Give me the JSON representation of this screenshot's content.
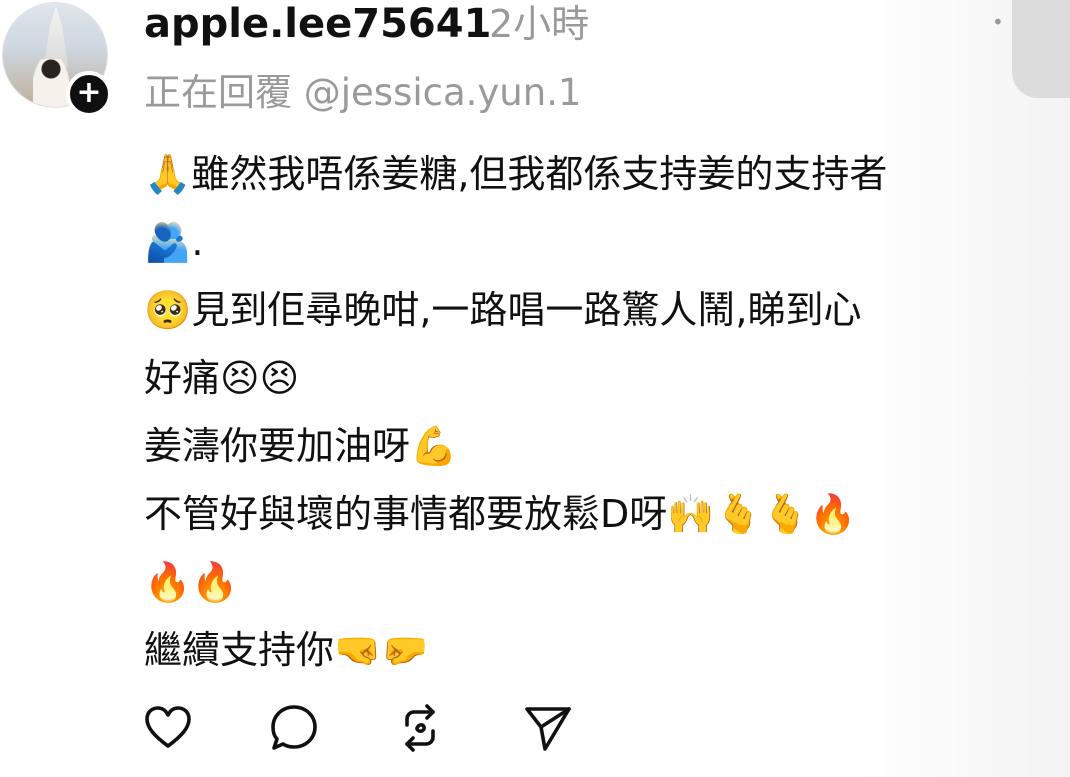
{
  "post": {
    "username": "apple.lee75641",
    "time_ago": "2小時",
    "replying_to": "正在回覆 @jessica.yun.1",
    "content_lines": [
      "🙏雖然我唔係姜糖,但我都係支持姜的支持者",
      "🫂.",
      "🥺見到佢尋晚咁,一路唱一路驚人鬧,睇到心",
      "好痛😣😣",
      "姜濤你要加油呀💪",
      "不管好與壞的事情都要放鬆D呀🙌🫰🫰🔥",
      "🔥🔥",
      "繼續支持你🤜🤛"
    ]
  },
  "icons": {
    "follow": "plus-icon",
    "more": "more-options-icon",
    "like": "heart-icon",
    "comment": "comment-icon",
    "repost": "repost-icon",
    "share": "send-icon"
  },
  "colors": {
    "text": "#111111",
    "muted": "#9a9a9a",
    "badge": "#0f0f0f"
  }
}
